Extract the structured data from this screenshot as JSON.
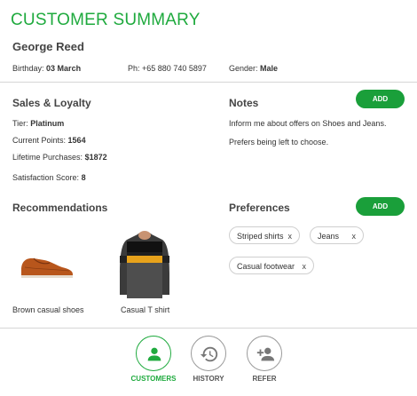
{
  "title": "CUSTOMER SUMMARY",
  "customer": {
    "name": "George Reed",
    "birthday_label": "Birthday:",
    "birthday": "03 March",
    "phone_label": "Ph:",
    "phone": "+65 880 740 5897",
    "gender_label": "Gender:",
    "gender": "Male"
  },
  "loyalty": {
    "heading": "Sales & Loyalty",
    "tier_label": "Tier:",
    "tier": "Platinum",
    "points_label": "Current Points:",
    "points": "1564",
    "purchases_label": "Lifetime Purchases:",
    "purchases": "$1872",
    "satisfaction_label": "Satisfaction Score:",
    "satisfaction": "8"
  },
  "notes": {
    "heading": "Notes",
    "add_label": "ADD",
    "items": [
      "Inform me about offers on Shoes and Jeans.",
      "Prefers being left to choose."
    ]
  },
  "recommendations": {
    "heading": "Recommendations",
    "items": [
      {
        "label": "Brown casual shoes",
        "icon": "brown-shoe-image"
      },
      {
        "label": "Casual T shirt",
        "icon": "striped-tshirt-image"
      }
    ]
  },
  "preferences": {
    "heading": "Preferences",
    "add_label": "ADD",
    "remove_glyph": "x",
    "chips": [
      "Striped shirts",
      "Jeans",
      "Casual footwear"
    ]
  },
  "nav": {
    "items": [
      {
        "label": "CUSTOMERS",
        "icon": "person-icon",
        "active": true
      },
      {
        "label": "HISTORY",
        "icon": "history-icon",
        "active": false
      },
      {
        "label": "REFER",
        "icon": "add-person-icon",
        "active": false
      }
    ]
  },
  "colors": {
    "accent": "#1faa3e",
    "button": "#1a9f3a",
    "divider": "#d6d6d6"
  }
}
